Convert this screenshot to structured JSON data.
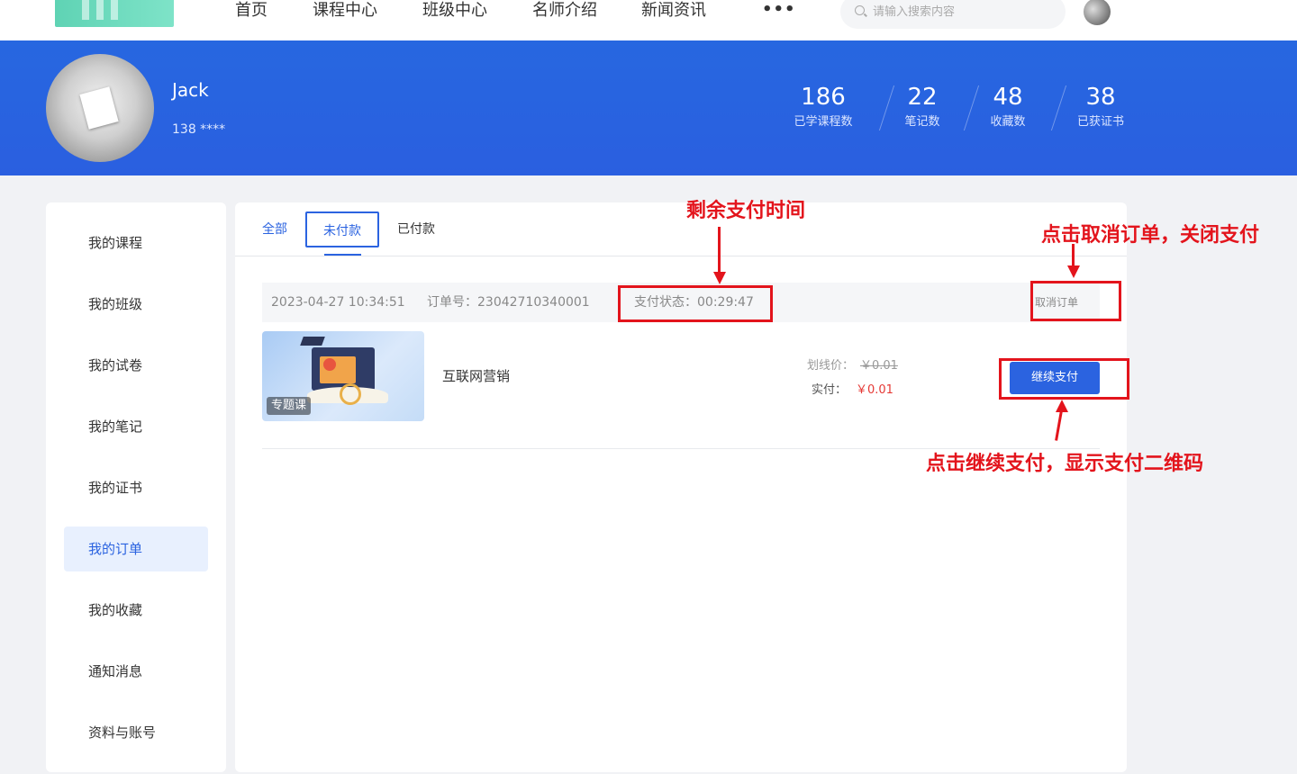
{
  "nav": {
    "items": [
      "首页",
      "课程中心",
      "班级中心",
      "名师介绍",
      "新闻资讯"
    ],
    "more_label": "•••",
    "search_placeholder": "请输入搜索内容"
  },
  "profile": {
    "name": "Jack",
    "phone": "138 ****",
    "stats": [
      {
        "value": "186",
        "label": "已学课程数"
      },
      {
        "value": "22",
        "label": "笔记数"
      },
      {
        "value": "48",
        "label": "收藏数"
      },
      {
        "value": "38",
        "label": "已获证书"
      }
    ]
  },
  "sidebar": {
    "items": [
      "我的课程",
      "我的班级",
      "我的试卷",
      "我的笔记",
      "我的证书",
      "我的订单",
      "我的收藏",
      "通知消息",
      "资料与账号"
    ],
    "active": "我的订单"
  },
  "tabs": {
    "all": "全部",
    "unpaid": "未付款",
    "paid": "已付款"
  },
  "order": {
    "time": "2023-04-27 10:34:51",
    "number": "订单号：23042710340001",
    "pay_status": "支付状态：00:29:47",
    "cancel_label": "取消订单",
    "course_tag": "专题课",
    "course_name": "互联网营销",
    "orig_price_label": "划线价：",
    "orig_price": "￥0.01",
    "pay_price_label": "实付：",
    "pay_price": "￥0.01",
    "pay_button": "继续支付"
  },
  "annotations": {
    "remaining_time": "剩余支付时间",
    "cancel_hint": "点击取消订单，关闭支付",
    "pay_hint": "点击继续支付，显示支付二维码"
  },
  "colors": {
    "brand_blue": "#2b63e0",
    "annotation_red": "#e3141c",
    "price_red": "#e53935"
  }
}
